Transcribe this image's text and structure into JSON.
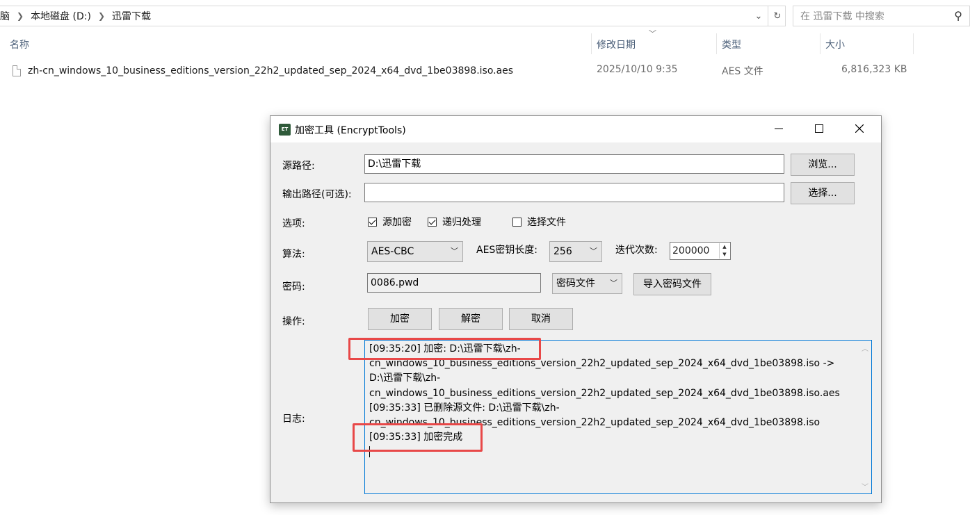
{
  "explorer": {
    "breadcrumb": [
      "脑",
      "本地磁盘 (D:)",
      "迅雷下载"
    ],
    "search_placeholder": "在 迅雷下载 中搜索",
    "columns": {
      "name": "名称",
      "modified": "修改日期",
      "type": "类型",
      "size": "大小"
    },
    "files": [
      {
        "name": "zh-cn_windows_10_business_editions_version_22h2_updated_sep_2024_x64_dvd_1be03898.iso.aes",
        "modified": "2025/10/10 9:35",
        "type": "AES 文件",
        "size": "6,816,323 KB"
      }
    ]
  },
  "dialog": {
    "title": "加密工具 (EncryptTools)",
    "icon_text": "ET",
    "labels": {
      "source": "源路径:",
      "output": "输出路径(可选):",
      "options": "选项:",
      "algorithm": "算法:",
      "key_length": "AES密钥长度:",
      "iterations": "迭代次数:",
      "password": "密码:",
      "operation": "操作:",
      "log": "日志:"
    },
    "source_path": "D:\\迅雷下载",
    "output_path": "",
    "browse_button": "浏览...",
    "select_button": "选择...",
    "options": [
      {
        "label": "源加密",
        "checked": true
      },
      {
        "label": "递归处理",
        "checked": true
      },
      {
        "label": "选择文件",
        "checked": false
      }
    ],
    "algorithm": "AES-CBC",
    "key_length": "256",
    "iterations": "200000",
    "password_value": "0086.pwd",
    "password_mode": "密码文件",
    "import_password_button": "导入密码文件",
    "actions": {
      "encrypt": "加密",
      "decrypt": "解密",
      "cancel": "取消"
    },
    "log_lines": [
      "[09:35:20] 加密: D:\\迅雷下载\\zh-",
      "cn_windows_10_business_editions_version_22h2_updated_sep_2024_x64_dvd_1be03898.iso ->",
      "D:\\迅雷下载\\zh-",
      "cn_windows_10_business_editions_version_22h2_updated_sep_2024_x64_dvd_1be03898.iso.aes",
      "[09:35:33] 已删除源文件: D:\\迅雷下载\\zh-",
      "cn_windows_10_business_editions_version_22h2_updated_sep_2024_x64_dvd_1be03898.iso",
      "[09:35:33] 加密完成"
    ]
  },
  "annotation_color": "#e84848"
}
